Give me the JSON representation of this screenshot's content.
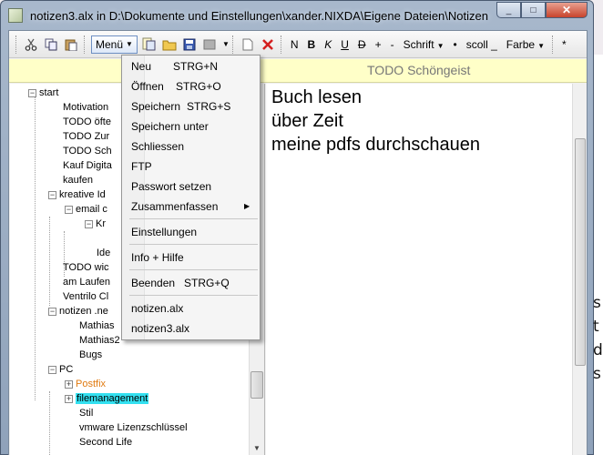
{
  "window": {
    "title": "notizen3.alx in D:\\Dokumente und Einstellungen\\xander.NIXDA\\Eigene Dateien\\Notizen",
    "minimize_glyph": "_",
    "maximize_glyph": "□",
    "close_glyph": "✕"
  },
  "toolbar": {
    "menu_label": "Menü",
    "bold_label": "B",
    "italic_label": "K",
    "underline_label": "U",
    "strike_label": "D",
    "n_label": "N",
    "plus_label": "+",
    "minus_label": "-",
    "font_label": "Schrift",
    "dot_label": "•",
    "scroll_label": "scoll _",
    "color_label": "Farbe",
    "star_label": "*",
    "icons": [
      "cut-icon",
      "copy-icon",
      "paste-icon",
      "new-note-icon",
      "open-folder-icon",
      "save-icon",
      "gray-box-icon",
      "blank-page-icon",
      "delete-icon"
    ]
  },
  "header": {
    "title": "TODO Schöngeist"
  },
  "tree": {
    "items": [
      {
        "label": "start"
      },
      {
        "label": "Motivation"
      },
      {
        "label": "TODO öfte"
      },
      {
        "label": "TODO Zur"
      },
      {
        "label": "TODO Sch"
      },
      {
        "label": "Kauf Digita"
      },
      {
        "label": "kaufen"
      },
      {
        "label": "kreative Id"
      },
      {
        "label": "email c"
      },
      {
        "label": "Kr"
      },
      {
        "label": "Ide"
      },
      {
        "label": "TODO wic"
      },
      {
        "label": "am Laufen"
      },
      {
        "label": "Ventrilo Cl"
      },
      {
        "label": "notizen .ne"
      },
      {
        "label": "Mathias"
      },
      {
        "label": "Mathias2"
      },
      {
        "label": "Bugs"
      },
      {
        "label": "PC"
      },
      {
        "label": "Postfix"
      },
      {
        "label": "filemanagement"
      },
      {
        "label": "Stil"
      },
      {
        "label": "vmware Lizenzschlüssel"
      },
      {
        "label": "Second Life"
      }
    ]
  },
  "editor": {
    "lines": [
      "Buch lesen",
      "über Zeit",
      "meine pdfs durchschauen"
    ]
  },
  "menu": {
    "items": [
      {
        "label": "Neu",
        "shortcut": "STRG+N"
      },
      {
        "label": "Öffnen",
        "shortcut": "STRG+O"
      },
      {
        "label": "Speichern",
        "shortcut": "STRG+S"
      },
      {
        "label": "Speichern unter",
        "shortcut": ""
      },
      {
        "label": "Schliessen",
        "shortcut": ""
      },
      {
        "label": "FTP",
        "shortcut": ""
      },
      {
        "label": "Passwort setzen",
        "shortcut": ""
      },
      {
        "label": "Zusammenfassen",
        "shortcut": ""
      },
      {
        "label": "Einstellungen",
        "shortcut": ""
      },
      {
        "label": "Info + Hilfe",
        "shortcut": ""
      },
      {
        "label": "Beenden",
        "shortcut": "STRG+Q"
      },
      {
        "label": "notizen.alx",
        "shortcut": ""
      },
      {
        "label": "notizen3.alx",
        "shortcut": ""
      }
    ]
  },
  "colors": {
    "selected_highlight": "#33e0f0",
    "orange_item": "#e07a10",
    "header_band": "#ffffc8"
  }
}
